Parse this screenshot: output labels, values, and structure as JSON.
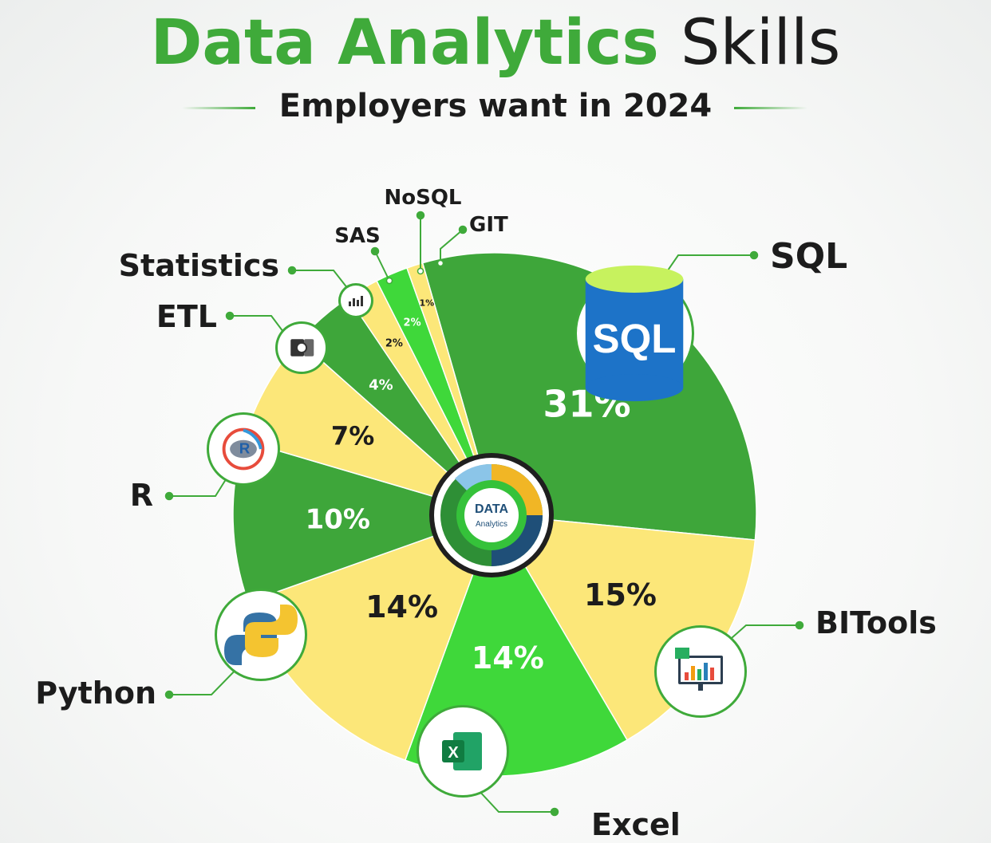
{
  "title_part1": "Data Analytics",
  "title_part2": "Skills",
  "subtitle": "Employers want in 2024",
  "center_badge": {
    "line1": "DATA",
    "line2": "Analytics"
  },
  "colors": {
    "green_dark": "#3ea63a",
    "green_bright": "#3fd83a",
    "yellow": "#fce779",
    "accent": "#3faa3a"
  },
  "chart_data": {
    "type": "pie",
    "title": "Data Analytics Skills",
    "subtitle": "Employers want in 2024",
    "slices": [
      {
        "label": "SQL",
        "value": 31,
        "display": "31%",
        "color": "#3ea63a",
        "icon": "sql-database-icon"
      },
      {
        "label": "BITools",
        "value": 15,
        "display": "15%",
        "color": "#fce779",
        "icon": "bi-dashboard-icon"
      },
      {
        "label": "Excel",
        "value": 14,
        "display": "14%",
        "color": "#3fd83a",
        "icon": "excel-icon"
      },
      {
        "label": "Python",
        "value": 14,
        "display": "14%",
        "color": "#fce779",
        "icon": "python-icon"
      },
      {
        "label": "R",
        "value": 10,
        "display": "10%",
        "color": "#3ea63a",
        "icon": "r-language-icon"
      },
      {
        "label": "ETL",
        "value": 7,
        "display": "7%",
        "color": "#fce779",
        "icon": "etl-icon"
      },
      {
        "label": "Statistics",
        "value": 4,
        "display": "4%",
        "color": "#3ea63a",
        "icon": "statistics-icon"
      },
      {
        "label": "SAS",
        "value": 2,
        "display": "2%",
        "color": "#fce779",
        "icon": ""
      },
      {
        "label": "NoSQL",
        "value": 2,
        "display": "2%",
        "color": "#3fd83a",
        "icon": ""
      },
      {
        "label": "GIT",
        "value": 1,
        "display": "1%",
        "color": "#fce779",
        "icon": ""
      }
    ]
  }
}
